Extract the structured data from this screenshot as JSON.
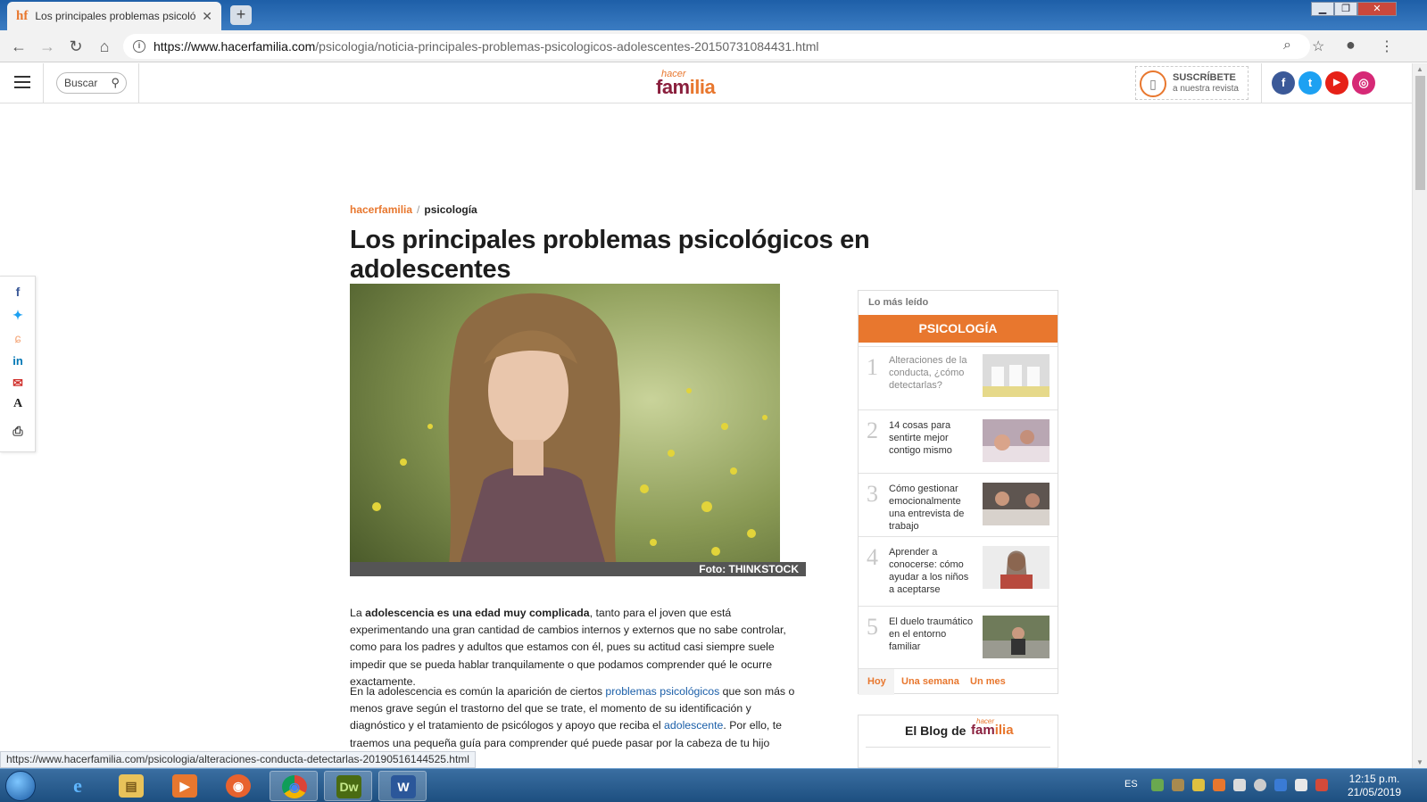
{
  "browser": {
    "tab_title": "Los principales problemas psicológicos",
    "tab_favicon_text": "hf",
    "tab_close": "✕",
    "new_tab": "+",
    "url_host": "https://www.hacerfamilia.com",
    "url_path": "/psicologia/noticia-principales-problemas-psicologicos-adolescentes-20150731084431.html",
    "window_minimize": "▁",
    "window_restore": "❐",
    "window_close": "✕"
  },
  "header": {
    "search_placeholder": "Buscar",
    "logo_small": "hacer",
    "logo_big_a": "fam",
    "logo_big_b": "ilia",
    "subscribe_line1": "SUSCRÍBETE",
    "subscribe_line2": "a nuestra revista",
    "social": [
      {
        "icon": "facebook-icon",
        "glyph": "f",
        "color": "#3b5998"
      },
      {
        "icon": "twitter-icon",
        "glyph": "t",
        "color": "#1da1f2"
      },
      {
        "icon": "youtube-icon",
        "glyph": "▶",
        "color": "#e62117"
      },
      {
        "icon": "instagram-icon",
        "glyph": "◎",
        "color": "#d62976"
      }
    ]
  },
  "share": [
    {
      "icon": "facebook-icon",
      "glyph": "f",
      "color": "#3b5998"
    },
    {
      "icon": "twitter-icon",
      "glyph": "✦",
      "color": "#1da1f2"
    },
    {
      "icon": "meneame-icon",
      "glyph": "ɕ",
      "color": "#f5a77a"
    },
    {
      "icon": "linkedin-icon",
      "glyph": "in",
      "color": "#0077b5"
    },
    {
      "icon": "email-icon",
      "glyph": "✉",
      "color": "#d0302c"
    },
    {
      "icon": "font-size-icon",
      "glyph": "A",
      "color": "#222222"
    },
    {
      "icon": "print-icon",
      "glyph": "⎙",
      "color": "#444444"
    }
  ],
  "article": {
    "breadcrumb_home": "hacerfamilia",
    "breadcrumb_sep": "/",
    "breadcrumb_section": "psicología",
    "title": "Los principales problemas psicológicos en adolescentes",
    "photo_credit": "Foto: THINKSTOCK",
    "p1_bold": "adolescencia es una edad muy complicada",
    "p1_pre": "La ",
    "p1_rest": ", tanto para el joven que está experimentando una gran cantidad de cambios internos y externos que no sabe controlar, como para los padres y adultos que estamos con él, pues su actitud casi siempre suele impedir que se pueda hablar tranquilamente o que podamos comprender qué le ocurre exactamente.",
    "p2_pre": "En la adolescencia es común la aparición de ciertos ",
    "p2_link1": "problemas psicológicos",
    "p2_mid": " que son más o menos grave según el trastorno del que se trate, el momento de su identificación y diagnóstico y el tratamiento de psicólogos y apoyo que reciba el ",
    "p2_link2": "adolescente",
    "p2_rest": ". Por ello, te traemos una pequeña guía para comprender qué puede pasar por la cabeza de tu hijo"
  },
  "sidebar": {
    "most_read_label": "Lo más leído",
    "category": "PSICOLOGÍA",
    "items": [
      {
        "num": "1",
        "title": "Alteraciones de la conducta, ¿cómo detectarlas?"
      },
      {
        "num": "2",
        "title": "14 cosas para sentirte mejor contigo mismo"
      },
      {
        "num": "3",
        "title": "Cómo gestionar emocionalmente una entrevista de trabajo"
      },
      {
        "num": "4",
        "title": "Aprender a conocerse: cómo ayudar a los niños a aceptarse"
      },
      {
        "num": "5",
        "title": "El duelo traumático en el entorno familiar"
      }
    ],
    "tabs": [
      "Hoy",
      "Una semana",
      "Un mes"
    ],
    "blog_label": "El Blog de",
    "blog_logo_small": "hacer",
    "blog_logo_a": "fam",
    "blog_logo_b": "ilia"
  },
  "status_url": "https://www.hacerfamilia.com/psicologia/alteraciones-conducta-detectarlas-20190516144525.html",
  "taskbar": {
    "lang": "ES",
    "time": "12:15 p.m.",
    "date": "21/05/2019",
    "apps": [
      {
        "name": "internet-explorer",
        "glyph": "e",
        "color": "#2f8fd8"
      },
      {
        "name": "file-explorer",
        "glyph": "▤",
        "color": "#e8c25a"
      },
      {
        "name": "media-player",
        "glyph": "▶",
        "color": "#e8772e"
      },
      {
        "name": "firefox",
        "glyph": "◉",
        "color": "#e8622e"
      },
      {
        "name": "chrome",
        "glyph": "◉",
        "color": "#4caf50"
      },
      {
        "name": "dreamweaver",
        "glyph": "Dw",
        "color": "#5a7a1f"
      },
      {
        "name": "word",
        "glyph": "W",
        "color": "#2b579a"
      }
    ]
  }
}
